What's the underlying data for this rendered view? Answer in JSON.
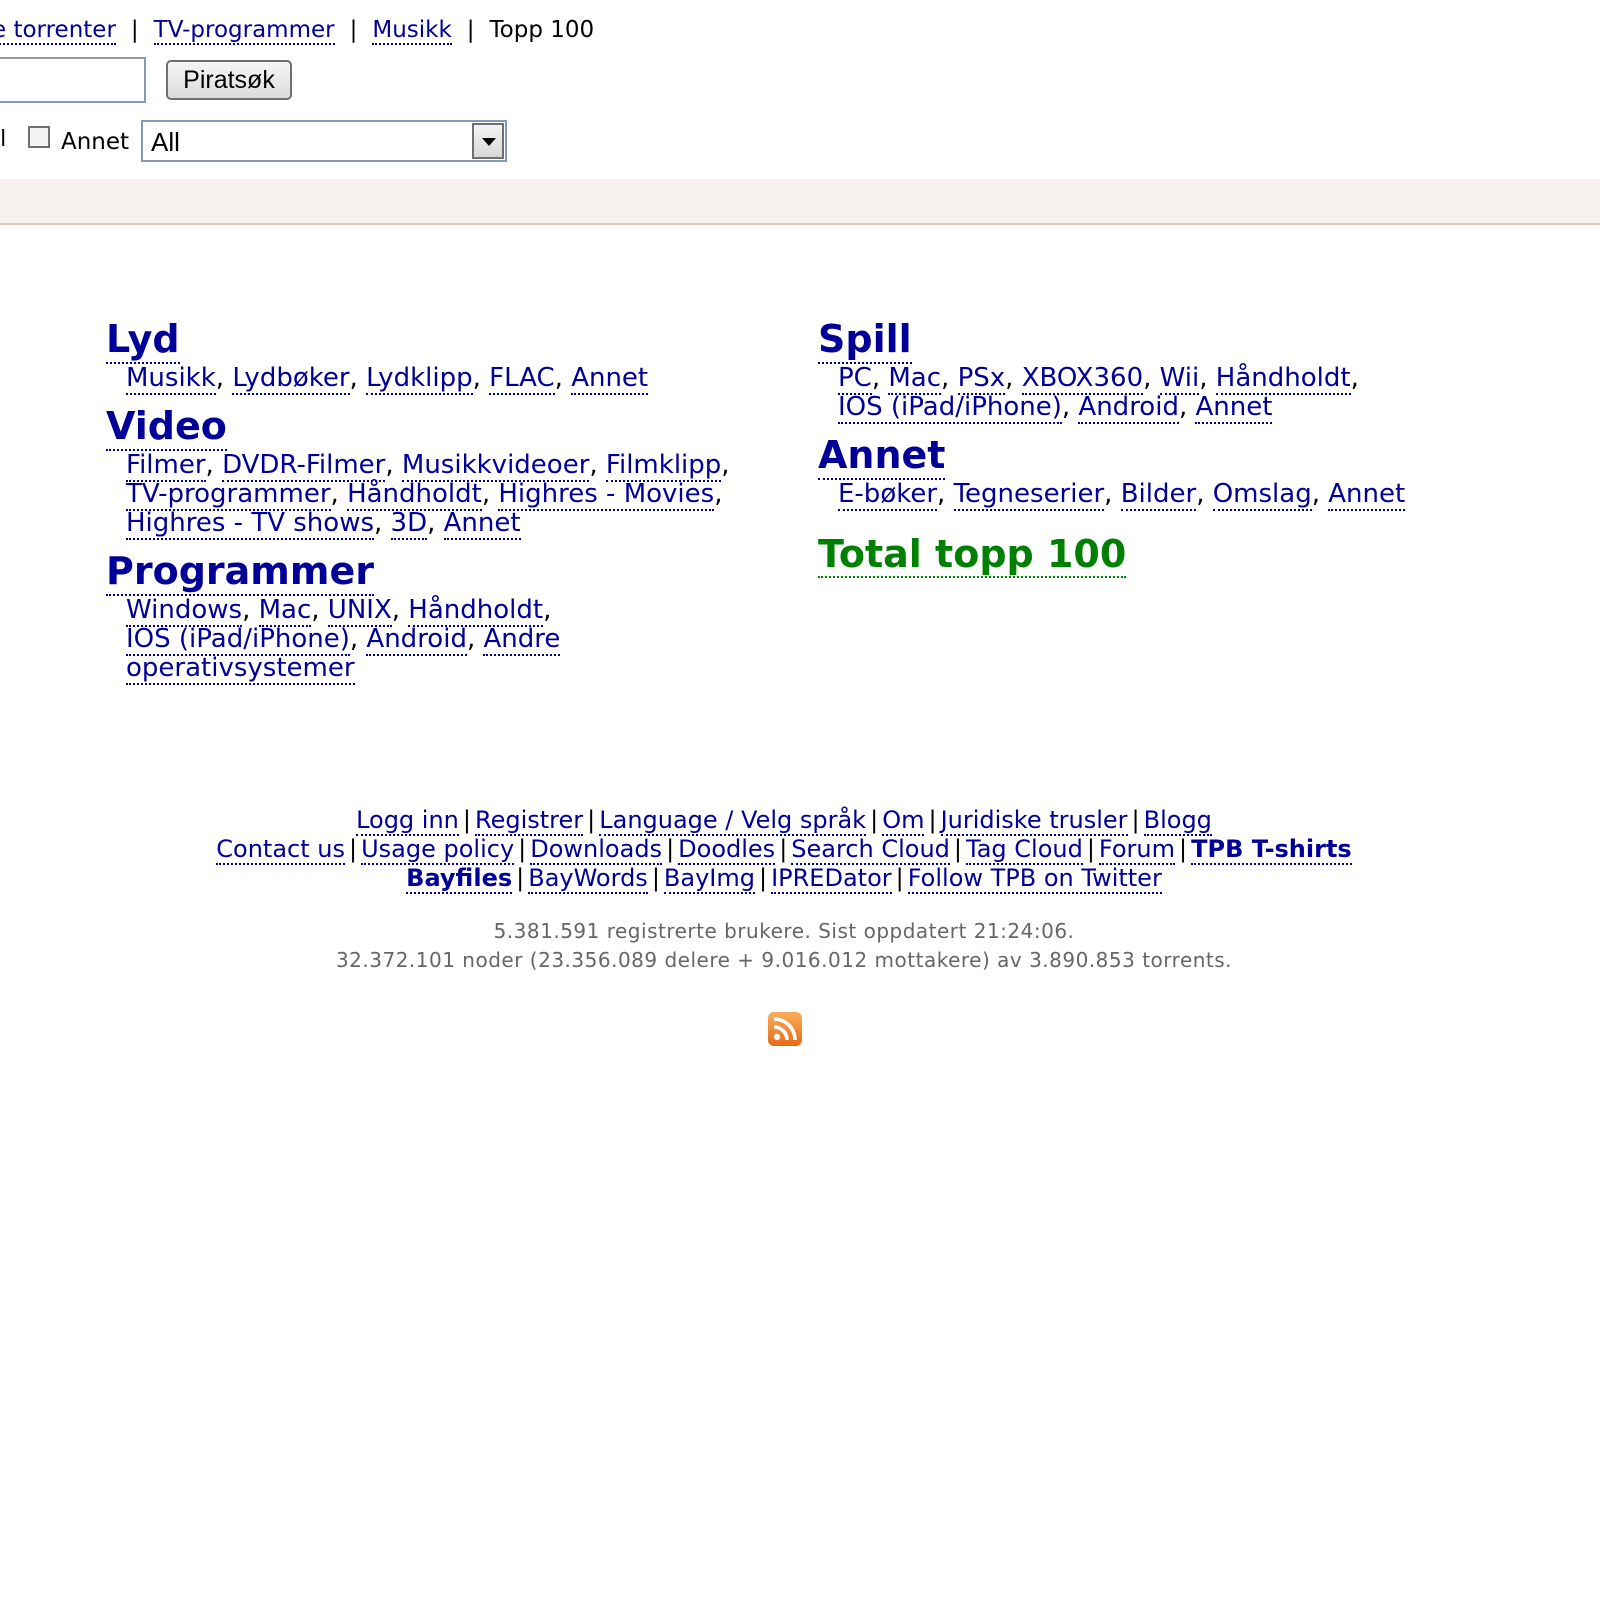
{
  "topnav": {
    "items": [
      {
        "label": "e torrenter",
        "link": true
      },
      {
        "label": "TV-programmer",
        "link": true
      },
      {
        "label": "Musikk",
        "link": true
      },
      {
        "label": "Topp 100",
        "link": false
      }
    ]
  },
  "search": {
    "value": "",
    "button_label": "Piratsøk"
  },
  "category_row": {
    "cut_label": "ll",
    "annet_label": "Annet",
    "annet_checked": false,
    "select_value": "All"
  },
  "categories": {
    "left": [
      {
        "title": "Lyd",
        "links": [
          "Musikk",
          "Lydbøker",
          "Lydklipp",
          "FLAC",
          "Annet"
        ]
      },
      {
        "title": "Video",
        "links": [
          "Filmer",
          "DVDR-Filmer",
          "Musikkvideoer",
          "Filmklipp",
          "TV-programmer",
          "Håndholdt",
          "Highres - Movies",
          "Highres - TV shows",
          "3D",
          "Annet"
        ]
      },
      {
        "title": "Programmer",
        "links": [
          "Windows",
          "Mac",
          "UNIX",
          "Håndholdt",
          "IOS (iPad/iPhone)",
          "Android",
          "Andre operativsystemer"
        ]
      }
    ],
    "right": [
      {
        "title": "Spill",
        "links": [
          "PC",
          "Mac",
          "PSx",
          "XBOX360",
          "Wii",
          "Håndholdt",
          "IOS (iPad/iPhone)",
          "Android",
          "Annet"
        ]
      },
      {
        "title": "Annet",
        "links": [
          "E-bøker",
          "Tegneserier",
          "Bilder",
          "Omslag",
          "Annet"
        ]
      }
    ],
    "total_top": "Total topp 100"
  },
  "footer": {
    "lines": [
      [
        {
          "label": "Logg inn"
        },
        {
          "label": "Registrer"
        },
        {
          "label": "Language / Velg språk"
        },
        {
          "label": "Om"
        },
        {
          "label": "Juridiske trusler"
        },
        {
          "label": "Blogg"
        }
      ],
      [
        {
          "label": "Contact us"
        },
        {
          "label": "Usage policy"
        },
        {
          "label": "Downloads"
        },
        {
          "label": "Doodles"
        },
        {
          "label": "Search Cloud"
        },
        {
          "label": "Tag Cloud"
        },
        {
          "label": "Forum"
        },
        {
          "label": "TPB T-shirts",
          "bold": true
        }
      ],
      [
        {
          "label": "Bayfiles",
          "bold": true
        },
        {
          "label": "BayWords"
        },
        {
          "label": "BayImg"
        },
        {
          "label": "IPREDator"
        },
        {
          "label": "Follow TPB on Twitter"
        }
      ]
    ],
    "stats_line1": "5.381.591 registrerte brukere. Sist oppdatert 21:24:06.",
    "stats_line2": "32.372.101 noder (23.356.089 delere + 9.016.012 mottakere) av 3.890.853 torrents."
  },
  "icons": {
    "rss": "rss-feed-icon"
  },
  "colors": {
    "link": "#000099",
    "total_top": "#008000",
    "band": "#f6f1ee",
    "rss": "#f07f1e"
  }
}
